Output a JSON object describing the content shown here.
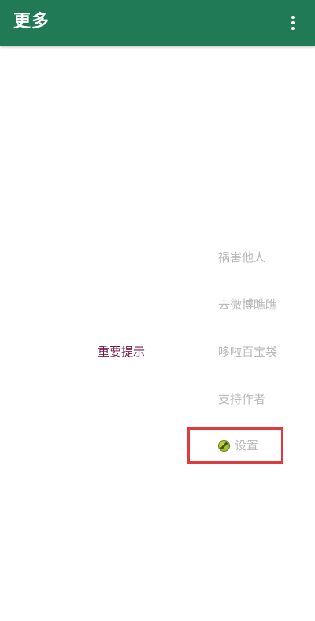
{
  "appbar": {
    "title": "更多",
    "background": "#1f7a55",
    "overflow_icon": "more-vert-icon"
  },
  "menu": {
    "items": [
      {
        "label": "祸害他人"
      },
      {
        "label": "去微博瞧瞧"
      },
      {
        "label": "哆啦百宝袋"
      },
      {
        "label": "支持作者"
      }
    ],
    "settings": {
      "label": "设置",
      "icon": "settings-badge-icon"
    }
  },
  "important_link": {
    "label": "重要提示",
    "color": "#7a1a4a"
  },
  "highlight_color": "#e0393e"
}
